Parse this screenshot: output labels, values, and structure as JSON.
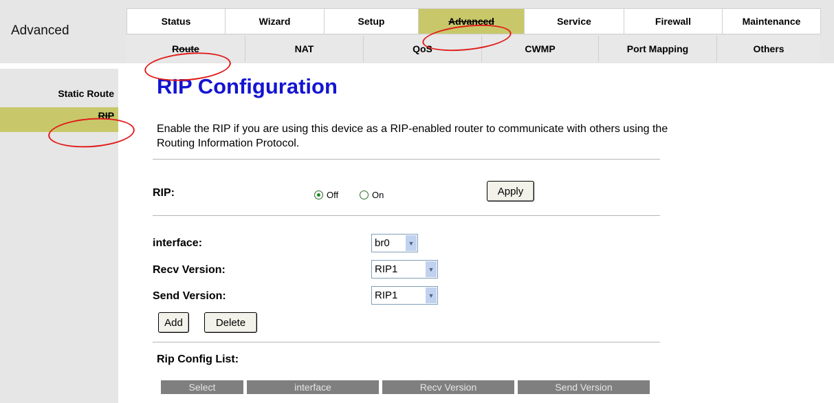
{
  "brand": "Advanced",
  "main_tabs": [
    {
      "label": "Status"
    },
    {
      "label": "Wizard"
    },
    {
      "label": "Setup"
    },
    {
      "label": "Advanced"
    },
    {
      "label": "Service"
    },
    {
      "label": "Firewall"
    },
    {
      "label": "Maintenance"
    }
  ],
  "sub_tabs": [
    {
      "label": "Route"
    },
    {
      "label": "NAT"
    },
    {
      "label": "QoS"
    },
    {
      "label": "CWMP"
    },
    {
      "label": "Port Mapping"
    },
    {
      "label": "Others"
    }
  ],
  "sidebar": {
    "items": [
      {
        "label": "Static Route"
      },
      {
        "label": "RIP"
      }
    ]
  },
  "main": {
    "title": "RIP Configuration",
    "intro": "Enable the RIP if you are using this device as a RIP-enabled router to communicate with others using the Routing Information Protocol.",
    "rip": {
      "label": "RIP:",
      "off_label": "Off",
      "on_label": "On",
      "selected": "Off",
      "apply_label": "Apply"
    },
    "form": {
      "interface_label": "interface:",
      "interface_value": "br0",
      "recv_label": "Recv Version:",
      "recv_value": "RIP1",
      "send_label": "Send Version:",
      "send_value": "RIP1",
      "add_label": "Add",
      "delete_label": "Delete"
    },
    "list": {
      "title": "Rip Config List:",
      "columns": [
        "Select",
        "interface",
        "Recv Version",
        "Send Version"
      ]
    }
  },
  "colors": {
    "active_tab": "#c8c86a",
    "title": "#1414d2",
    "annotation": "#e21b1b",
    "header_bg": "#e6e6e6"
  }
}
